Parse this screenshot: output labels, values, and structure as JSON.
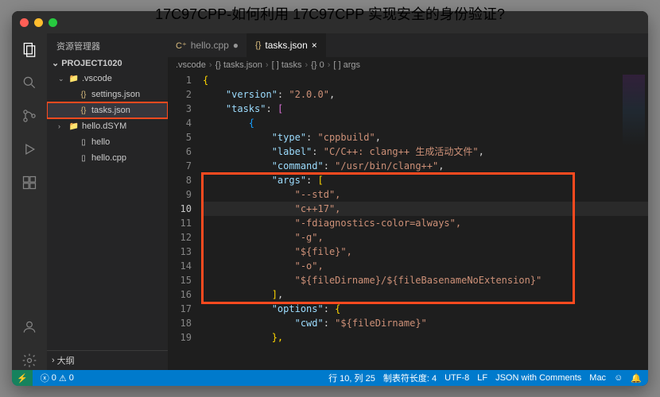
{
  "watermark": "17C97CPP-如何利用 17C97CPP 实现安全的身份验证?",
  "sidebar": {
    "title": "资源管理器",
    "project": "PROJECT1020",
    "tree": [
      {
        "label": ".vscode",
        "depth": 1,
        "folder": true,
        "open": true,
        "icon": "📁"
      },
      {
        "label": "settings.json",
        "depth": 2,
        "icon": "{}",
        "iconClass": "json-ic"
      },
      {
        "label": "tasks.json",
        "depth": 2,
        "icon": "{}",
        "iconClass": "json-ic",
        "selected": true,
        "highlighted": true
      },
      {
        "label": "hello.dSYM",
        "depth": 1,
        "folder": true,
        "open": false,
        "icon": "📁"
      },
      {
        "label": "hello",
        "depth": 2,
        "icon": "▯"
      },
      {
        "label": "hello.cpp",
        "depth": 2,
        "icon": "▯"
      }
    ],
    "outline": "大纲"
  },
  "tabs": [
    {
      "label": "hello.cpp",
      "icon": "C⁺",
      "active": false,
      "dirty": true
    },
    {
      "label": "tasks.json",
      "icon": "{}",
      "active": true
    }
  ],
  "breadcrumb": [
    ".vscode",
    "{} tasks.json",
    "[ ] tasks",
    "{} 0",
    "[ ] args"
  ],
  "lines": 19,
  "currentLine": 10,
  "statusbar": {
    "errors": "0",
    "warnings": "0",
    "lineCol": "行 10, 列 25",
    "tabSize": "制表符长度: 4",
    "encoding": "UTF-8",
    "eol": "LF",
    "lang": "JSON with Comments",
    "os": "Mac"
  },
  "code": {
    "l1": "{",
    "l2a": "    \"version\"",
    "l2b": ": ",
    "l2c": "\"2.0.0\"",
    "l2d": ",",
    "l3a": "    \"tasks\"",
    "l3b": ": ",
    "l3c": "[",
    "l4": "        {",
    "l5a": "            \"type\"",
    "l5b": ": ",
    "l5c": "\"cppbuild\"",
    "l5d": ",",
    "l6a": "            \"label\"",
    "l6b": ": ",
    "l6c": "\"C/C++: clang++ 生成活动文件\"",
    "l6d": ",",
    "l7a": "            \"command\"",
    "l7b": ": ",
    "l7c": "\"/usr/bin/clang++\"",
    "l7d": ",",
    "l8a": "            \"args\"",
    "l8b": ": ",
    "l8c": "[",
    "l9": "                \"--std\",",
    "l10": "                \"c++17\",",
    "l11": "                \"-fdiagnostics-color=always\",",
    "l12": "                \"-g\",",
    "l13": "                \"${file}\",",
    "l14": "                \"-o\",",
    "l15": "                \"${fileDirname}/${fileBasenameNoExtension}\"",
    "l16a": "            ",
    "l16b": "]",
    "l16c": ",",
    "l17a": "            \"options\"",
    "l17b": ": ",
    "l17c": "{",
    "l18a": "                \"cwd\"",
    "l18b": ": ",
    "l18c": "\"${fileDirname}\"",
    "l19": "            },"
  }
}
